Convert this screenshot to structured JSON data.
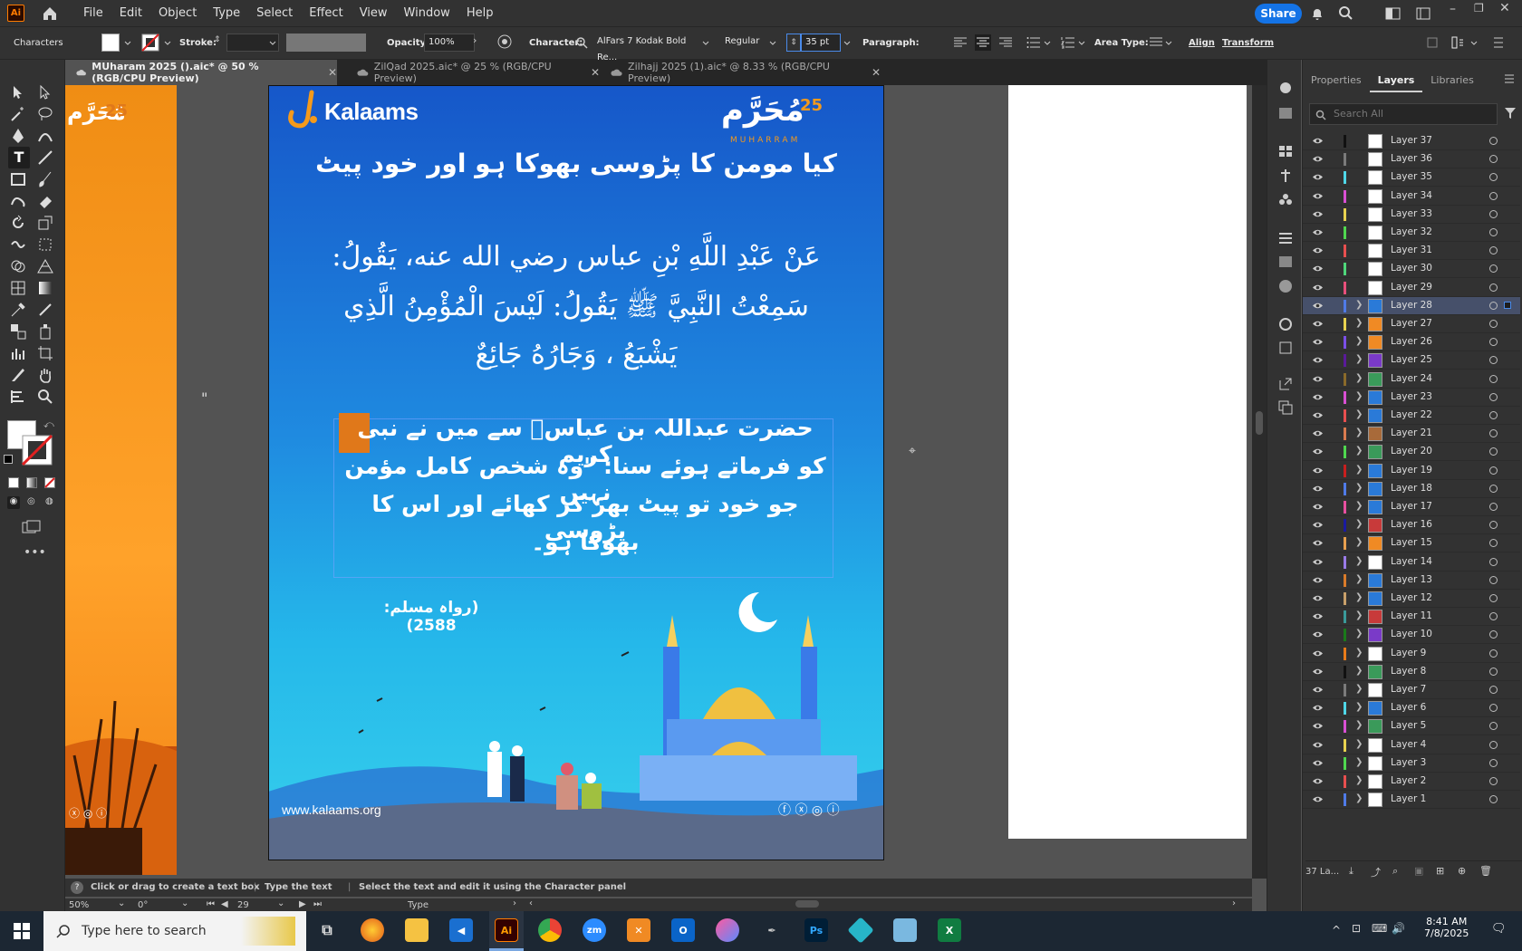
{
  "app": {
    "logo": "Ai"
  },
  "menu": [
    "File",
    "Edit",
    "Object",
    "Type",
    "Select",
    "Effect",
    "View",
    "Window",
    "Help"
  ],
  "share_label": "Share",
  "control": {
    "characters": "Characters",
    "stroke_label": "Stroke:",
    "opacity_label": "Opacity:",
    "opacity_value": "100%",
    "character_label": "Character:",
    "font_family": "AlFars 7 Kodak Bold Re...",
    "font_style": "Regular",
    "font_size": "35 pt",
    "paragraph_label": "Paragraph:",
    "area_type_label": "Area Type:",
    "align_label": "Align",
    "transform_label": "Transform"
  },
  "tabs": [
    {
      "label": "MUharam 2025 ().aic* @ 50 % (RGB/CPU Preview)",
      "active": true
    },
    {
      "label": "ZilQad 2025.aic* @ 25 % (RGB/CPU Preview)",
      "active": false
    },
    {
      "label": "Zilhajj 2025 (1).aic* @ 8.33 % (RGB/CPU Preview)",
      "active": false
    }
  ],
  "artwork": {
    "brand": "Kalaams",
    "brand_badge": "25",
    "muharram_ar": "مُحَرَّم",
    "muharram_en": "MUHARRAM",
    "heading": "کیا مومن کا پڑوسی بھوکا ہو اور خود پیٹ",
    "arabic_1": "عَنْ عَبْدِ اللَّهِ بْنِ عباس رضي الله عنه، يَقُولُ:",
    "arabic_2": "سَمِعْتُ النَّبِيَّ ﷺ يَقُولُ: لَيْسَ الْمُؤْمِنُ الَّذِي",
    "arabic_3": "يَشْبَعُ ، وَجَارُهُ جَائِعٌ",
    "urdu_1": "حضرت عبداللہ بن عباسؓ سے میں نے نبی کریم",
    "urdu_2": "کو فرماتے ہوئے سنا: \"وہ شخص کامل مؤمن نہیں",
    "urdu_3": "جو خود تو پیٹ بھر کر کھائے اور اس کا پڑوسی",
    "urdu_4": "بھوکا ہو۔",
    "reference": "(رواہ مسلم: 2588)",
    "website": "www.kalaams.org",
    "left_badge": "25"
  },
  "panel": {
    "tabs": [
      "Properties",
      "Layers",
      "Libraries"
    ],
    "active_tab": "Layers",
    "search_placeholder": "Search All",
    "layers": [
      {
        "name": "Layer 37",
        "color": "#111111",
        "expandable": false,
        "thumb": "white"
      },
      {
        "name": "Layer 36",
        "color": "#7b7b7b",
        "expandable": false,
        "thumb": "white"
      },
      {
        "name": "Layer 35",
        "color": "#4fd7e8",
        "expandable": false,
        "thumb": "white"
      },
      {
        "name": "Layer 34",
        "color": "#d94fd4",
        "expandable": false,
        "thumb": "white"
      },
      {
        "name": "Layer 33",
        "color": "#e8d24f",
        "expandable": false,
        "thumb": "white"
      },
      {
        "name": "Layer 32",
        "color": "#4fd74f",
        "expandable": false,
        "thumb": "white"
      },
      {
        "name": "Layer 31",
        "color": "#e84f4f",
        "expandable": false,
        "thumb": "white"
      },
      {
        "name": "Layer 30",
        "color": "#4fd77b",
        "expandable": false,
        "thumb": "white"
      },
      {
        "name": "Layer 29",
        "color": "#e84f7b",
        "expandable": false,
        "thumb": "white"
      },
      {
        "name": "Layer 28",
        "color": "#4f7be8",
        "expandable": true,
        "thumb": "blue",
        "selected": true
      },
      {
        "name": "Layer 27",
        "color": "#e8d24f",
        "expandable": true,
        "thumb": "orange"
      },
      {
        "name": "Layer 26",
        "color": "#7b4fe8",
        "expandable": true,
        "thumb": "orange"
      },
      {
        "name": "Layer 25",
        "color": "#5a1a9a",
        "expandable": true,
        "thumb": "purple"
      },
      {
        "name": "Layer 24",
        "color": "#8a6a2a",
        "expandable": true,
        "thumb": "green"
      },
      {
        "name": "Layer 23",
        "color": "#d94fd4",
        "expandable": true,
        "thumb": "blue"
      },
      {
        "name": "Layer 22",
        "color": "#e84f4f",
        "expandable": true,
        "thumb": "blue"
      },
      {
        "name": "Layer 21",
        "color": "#d97b4f",
        "expandable": true,
        "thumb": "brown"
      },
      {
        "name": "Layer 20",
        "color": "#4fd74f",
        "expandable": true,
        "thumb": "green"
      },
      {
        "name": "Layer 19",
        "color": "#c81e1e",
        "expandable": true,
        "thumb": "blue"
      },
      {
        "name": "Layer 18",
        "color": "#4f7be8",
        "expandable": true,
        "thumb": "blue"
      },
      {
        "name": "Layer 17",
        "color": "#e84fa0",
        "expandable": true,
        "thumb": "blue"
      },
      {
        "name": "Layer 16",
        "color": "#1a1aa0",
        "expandable": true,
        "thumb": "red"
      },
      {
        "name": "Layer 15",
        "color": "#e8a04f",
        "expandable": true,
        "thumb": "orange"
      },
      {
        "name": "Layer 14",
        "color": "#9a7be8",
        "expandable": true,
        "thumb": "white"
      },
      {
        "name": "Layer 13",
        "color": "#d97b2a",
        "expandable": true,
        "thumb": "blue"
      },
      {
        "name": "Layer 12",
        "color": "#c8a06a",
        "expandable": true,
        "thumb": "blue"
      },
      {
        "name": "Layer 11",
        "color": "#3a9a9a",
        "expandable": true,
        "thumb": "red"
      },
      {
        "name": "Layer 10",
        "color": "#1a7a1a",
        "expandable": true,
        "thumb": "purple"
      },
      {
        "name": "Layer 9",
        "color": "#e87b1a",
        "expandable": true,
        "thumb": "white"
      },
      {
        "name": "Layer 8",
        "color": "#111111",
        "expandable": true,
        "thumb": "green"
      },
      {
        "name": "Layer 7",
        "color": "#7b7b7b",
        "expandable": true,
        "thumb": "white"
      },
      {
        "name": "Layer 6",
        "color": "#4fd7e8",
        "expandable": true,
        "thumb": "blue"
      },
      {
        "name": "Layer 5",
        "color": "#d94fd4",
        "expandable": true,
        "thumb": "green"
      },
      {
        "name": "Layer 4",
        "color": "#e8d24f",
        "expandable": true,
        "thumb": "white"
      },
      {
        "name": "Layer 3",
        "color": "#4fd74f",
        "expandable": true,
        "thumb": "white"
      },
      {
        "name": "Layer 2",
        "color": "#e84f4f",
        "expandable": true,
        "thumb": "white"
      },
      {
        "name": "Layer 1",
        "color": "#4f7be8",
        "expandable": true,
        "thumb": "white"
      }
    ],
    "layer_count": "37 La..."
  },
  "status": {
    "hint": "Click or drag to create a text box",
    "hint2": "Type the text",
    "hint3": "Select the text and edit it using the Character panel",
    "zoom": "50%",
    "rotation": "0°",
    "artboard_num": "29",
    "tool_name": "Type"
  },
  "taskbar": {
    "search_placeholder": "Type here to search",
    "time": "8:41 AM",
    "date": "7/8/2025"
  }
}
